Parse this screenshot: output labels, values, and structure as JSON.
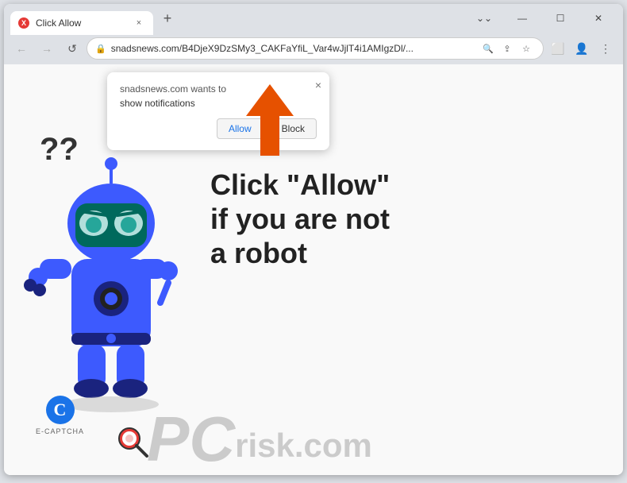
{
  "browser": {
    "tab": {
      "favicon": "X",
      "title": "Click Allow",
      "close": "×"
    },
    "new_tab_btn": "+",
    "window_controls": {
      "minimize": "—",
      "maximize": "☐",
      "close": "✕"
    },
    "nav": {
      "back": "←",
      "forward": "→",
      "refresh": "↺"
    },
    "url": "snadsnews.com/B4DjeX9DzSMy3_CAKFaYfiL_Var4wJjlT4i1AMIgzDl/...",
    "url_actions": {
      "search": "🔍",
      "share": "⇪",
      "star": "☆",
      "extensions": "⬜",
      "profile": "👤",
      "menu": "⋮"
    }
  },
  "notification_popup": {
    "site": "snadsnews.com wants to",
    "message": "show notifications",
    "close": "×",
    "allow_btn": "Allow",
    "block_btn": "Block"
  },
  "page": {
    "main_text_line1": "Click \"Allow\"",
    "main_text_line2": "if you are not",
    "main_text_line3": "a robot"
  },
  "ecaptcha": {
    "icon": "C",
    "label": "E-CAPTCHA"
  },
  "pcrisk": {
    "pc": "PC",
    "risk": "risk.com"
  }
}
